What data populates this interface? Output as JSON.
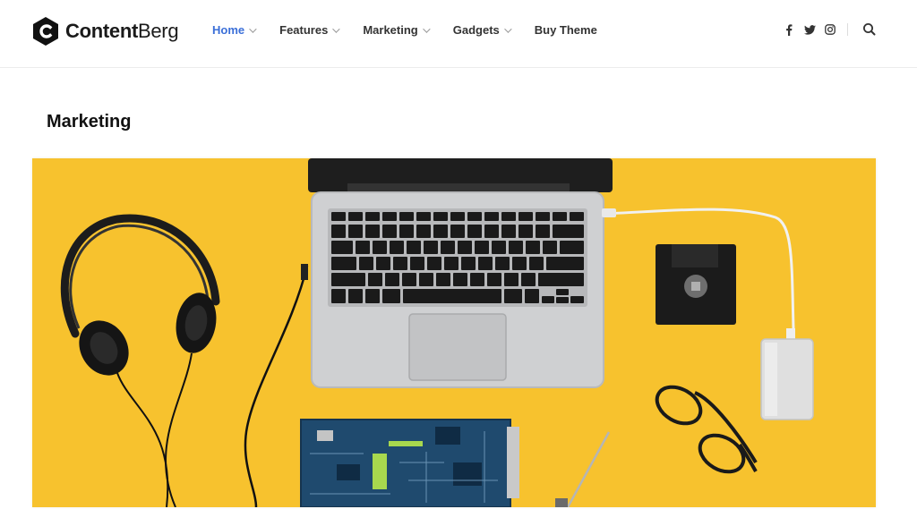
{
  "brand": {
    "name_bold": "Content",
    "name_light": "Berg"
  },
  "nav": {
    "items": [
      {
        "label": "Home",
        "active": true,
        "has_dropdown": true
      },
      {
        "label": "Features",
        "active": false,
        "has_dropdown": true
      },
      {
        "label": "Marketing",
        "active": false,
        "has_dropdown": true
      },
      {
        "label": "Gadgets",
        "active": false,
        "has_dropdown": true
      },
      {
        "label": "Buy Theme",
        "active": false,
        "has_dropdown": false
      }
    ]
  },
  "social": {
    "icons": [
      "facebook-icon",
      "twitter-icon",
      "instagram-icon"
    ]
  },
  "search": {
    "icon": "search-icon"
  },
  "page": {
    "title": "Marketing"
  },
  "hero": {
    "background_color": "#f7c22e",
    "accent_color": "#3b6fd8"
  }
}
